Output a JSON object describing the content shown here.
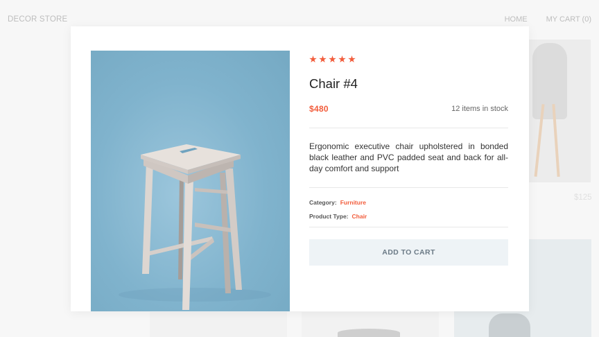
{
  "header": {
    "brand": "DECOR STORE",
    "nav": [
      {
        "label": "HOME"
      },
      {
        "label": "MY CART (0)"
      }
    ]
  },
  "background": {
    "price_partial": "$125"
  },
  "product": {
    "rating": 5,
    "title": "Chair #4",
    "price": "$480",
    "stock": "12 items in stock",
    "description": "Ergonomic executive chair upholstered in bonded black leather and PVC padded seat and back for all-day comfort and support",
    "category_label": "Category:",
    "category_value": "Furniture",
    "type_label": "Product Type:",
    "type_value": "Chair",
    "add_to_cart_label": "ADD TO CART"
  },
  "colors": {
    "accent": "#f25c3b",
    "photo_bg": "#80b3cd",
    "button_bg": "#eef3f6"
  },
  "icons": [
    "star-icon"
  ]
}
